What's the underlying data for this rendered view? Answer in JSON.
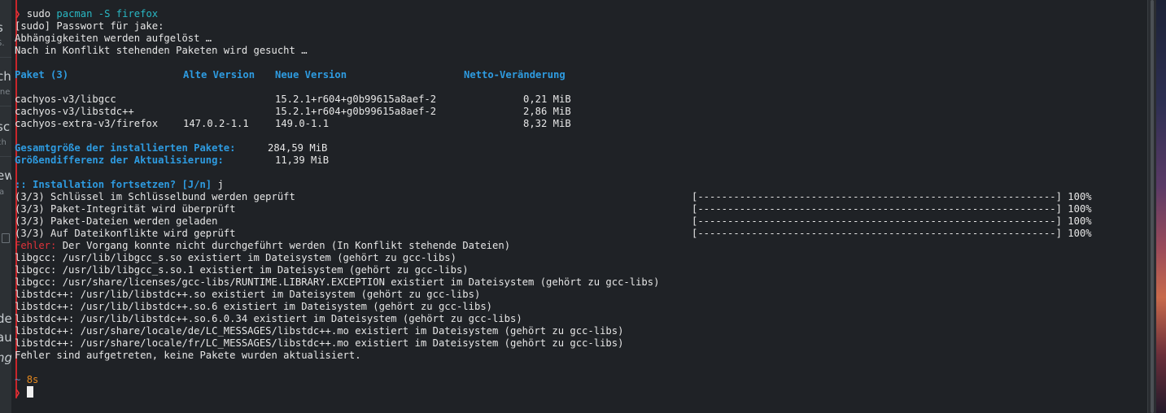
{
  "background_window": {
    "fragments": [
      "s",
      "S.",
      "ch",
      "rne",
      "sc",
      "ch",
      "ew",
      "Ja",
      "de",
      "au",
      "ng"
    ]
  },
  "terminal": {
    "prompt_symbol": "❯",
    "home_symbol": "~",
    "command": {
      "sudo": "sudo",
      "pacman": "pacman",
      "args": "-S firefox"
    },
    "lines": {
      "password": "[sudo] Passwort für jake:",
      "resolving": "Abhängigkeiten werden aufgelöst …",
      "conflicts": "Nach in Konflikt stehenden Paketen wird gesucht …"
    },
    "table": {
      "headers": [
        "Paket (3)",
        "Alte Version",
        "Neue Version",
        "Netto-Veränderung"
      ],
      "rows": [
        {
          "package": "cachyos-v3/libgcc",
          "old": "",
          "new": "15.2.1+r604+g0b99615a8aef-2",
          "net": "0,21 MiB"
        },
        {
          "package": "cachyos-v3/libstdc++",
          "old": "",
          "new": "15.2.1+r604+g0b99615a8aef-2",
          "net": "2,86 MiB"
        },
        {
          "package": "cachyos-extra-v3/firefox",
          "old": "147.0.2-1.1",
          "new": "149.0-1.1",
          "net": "8,32 MiB"
        }
      ]
    },
    "summary": {
      "installed_label": "Gesamtgröße der installierten Pakete:",
      "installed_value": "284,59 MiB",
      "diff_label": "Größendifferenz der Aktualisierung:",
      "diff_value": "11,39 MiB"
    },
    "confirm": {
      "question": ":: Installation fortsetzen? [J/n]",
      "answer": "j"
    },
    "progress_steps": [
      {
        "label": "(3/3) Schlüssel im Schlüsselbund werden geprüft",
        "bar": "[------------------------------------------------------------]",
        "pct": "100%",
        "progress": 1.0
      },
      {
        "label": "(3/3) Paket-Integrität wird überprüft",
        "bar": "[------------------------------------------------------------]",
        "pct": "100%",
        "progress": 1.0
      },
      {
        "label": "(3/3) Paket-Dateien werden geladen",
        "bar": "[------------------------------------------------------------]",
        "pct": "100%",
        "progress": 1.0
      },
      {
        "label": "(3/3) Auf Dateikonflikte wird geprüft",
        "bar": "[------------------------------------------------------------]",
        "pct": "100%",
        "progress": 1.0
      }
    ],
    "error": {
      "label": "Fehler:",
      "message": "Der Vorgang konnte nicht durchgeführt werden (In Konflikt stehende Dateien)"
    },
    "conflict_lines": [
      "libgcc: /usr/lib/libgcc_s.so existiert im Dateisystem (gehört zu gcc-libs)",
      "libgcc: /usr/lib/libgcc_s.so.1 existiert im Dateisystem (gehört zu gcc-libs)",
      "libgcc: /usr/share/licenses/gcc-libs/RUNTIME.LIBRARY.EXCEPTION existiert im Dateisystem (gehört zu gcc-libs)",
      "libstdc++: /usr/lib/libstdc++.so existiert im Dateisystem (gehört zu gcc-libs)",
      "libstdc++: /usr/lib/libstdc++.so.6 existiert im Dateisystem (gehört zu gcc-libs)",
      "libstdc++: /usr/lib/libstdc++.so.6.0.34 existiert im Dateisystem (gehört zu gcc-libs)",
      "libstdc++: /usr/share/locale/de/LC_MESSAGES/libstdc++.mo existiert im Dateisystem (gehört zu gcc-libs)",
      "libstdc++: /usr/share/locale/fr/LC_MESSAGES/libstdc++.mo existiert im Dateisystem (gehört zu gcc-libs)"
    ],
    "final_message": "Fehler sind aufgetreten, keine Pakete wurden aktualisiert.",
    "duration": "8s"
  },
  "colors": {
    "background": "#1f2226",
    "prompt": "#e0333a",
    "header": "#2e9be0",
    "command_cyan": "#29b8c4",
    "duration": "#e5891f"
  }
}
